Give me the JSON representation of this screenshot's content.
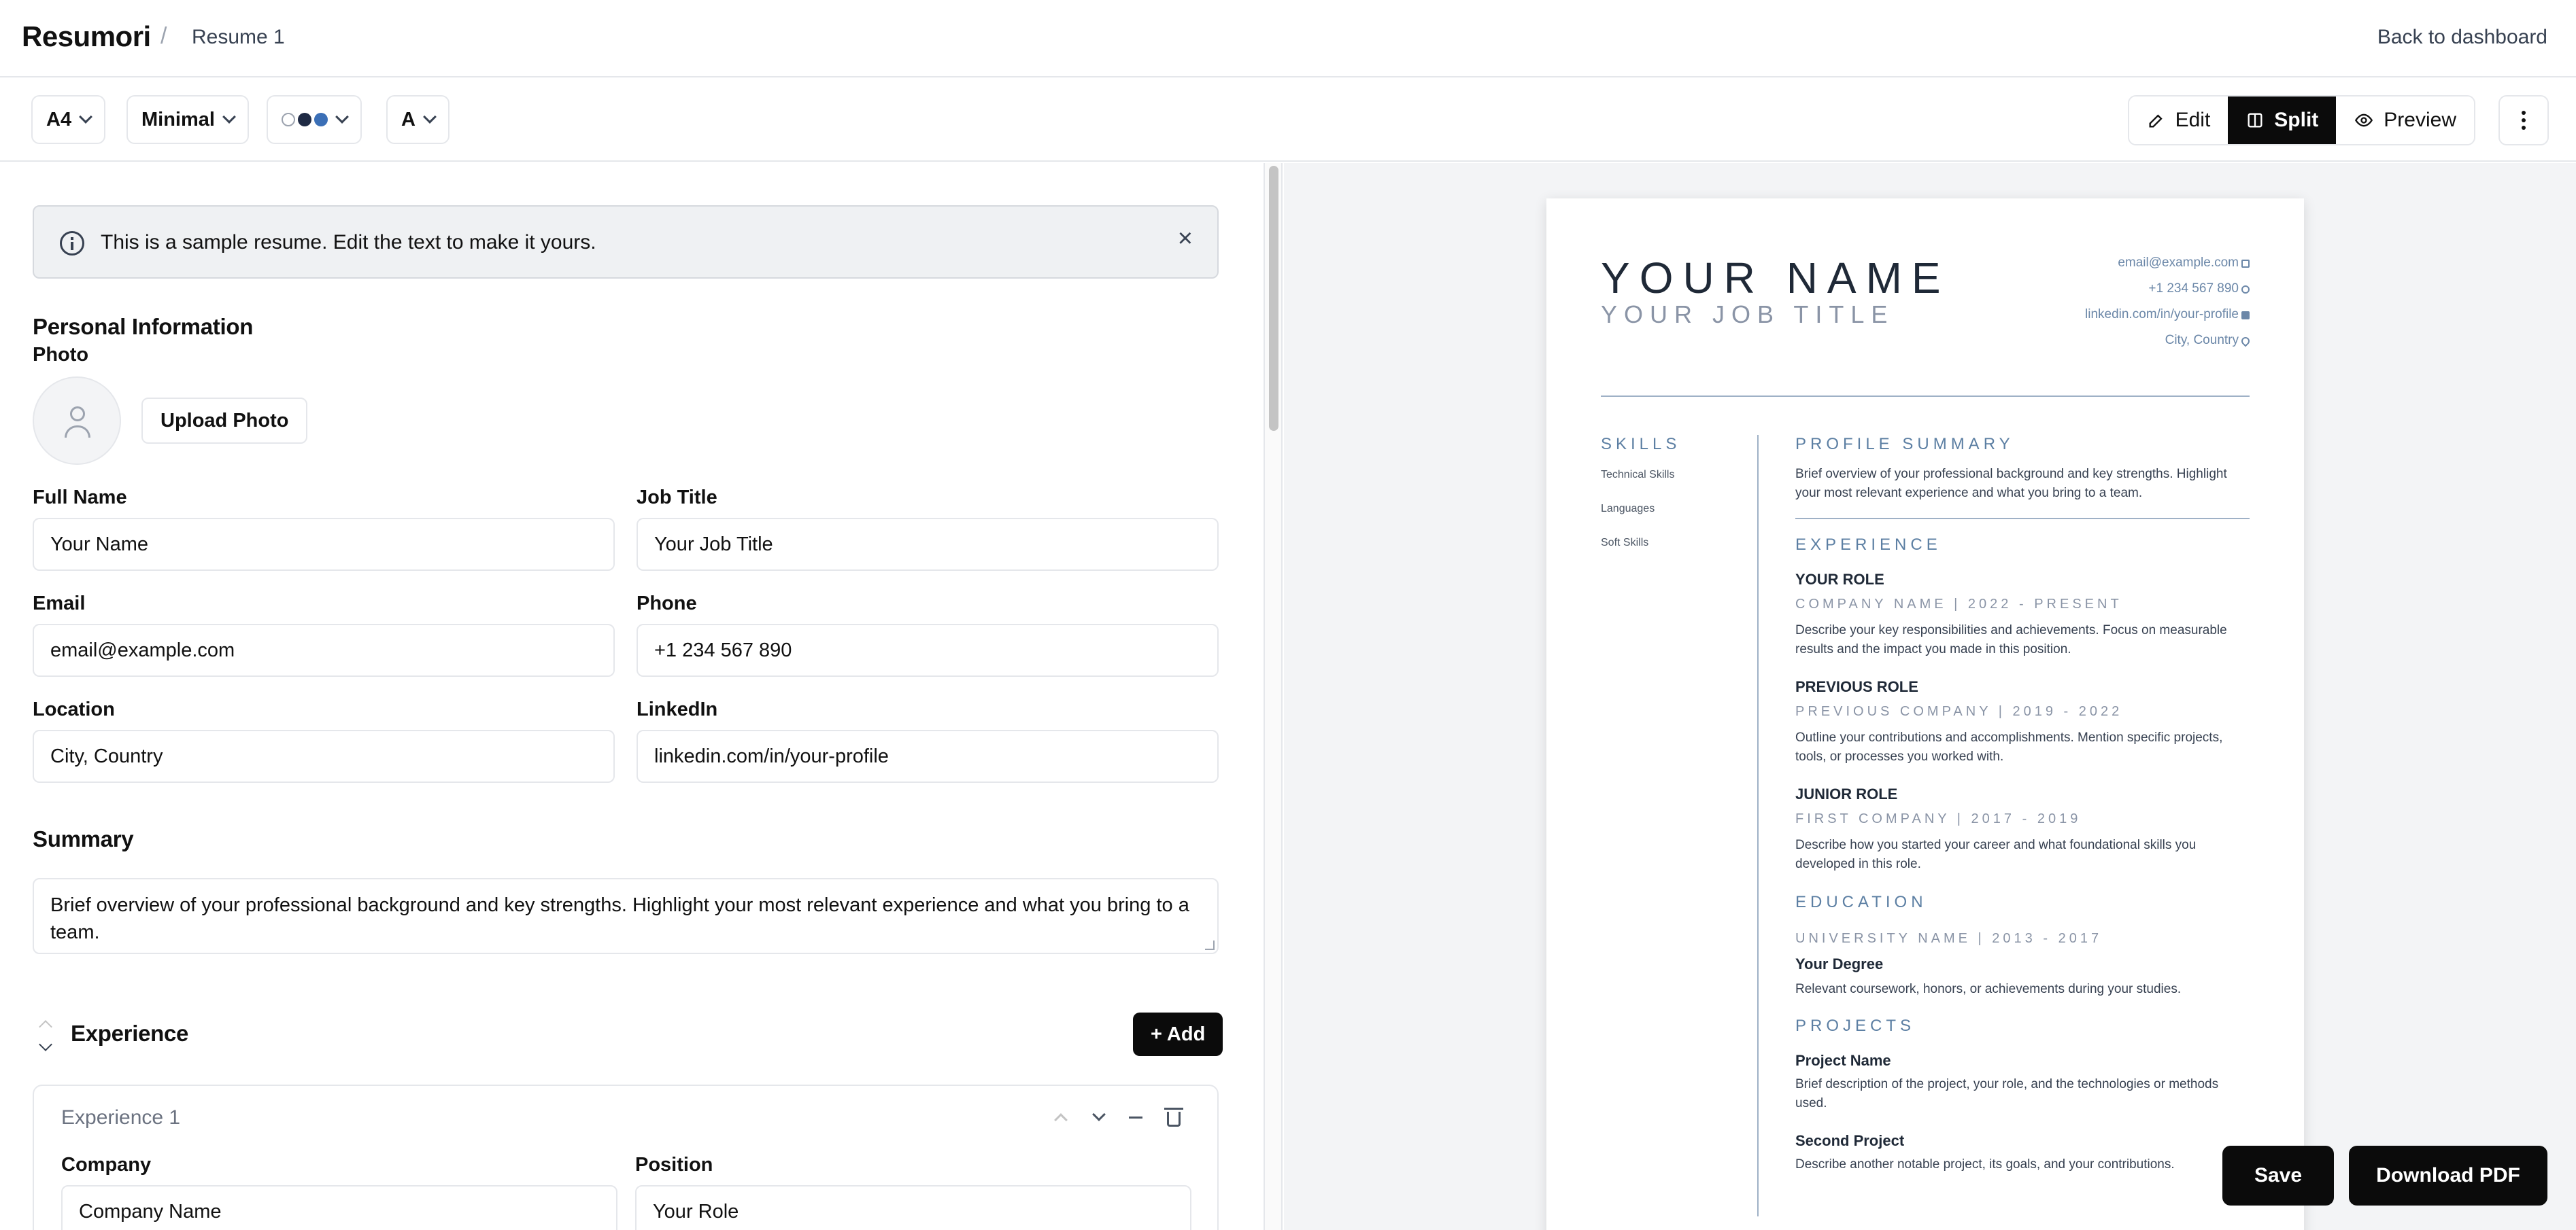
{
  "header": {
    "brand": "Resumori",
    "separator": "/",
    "breadcrumb": "Resume 1",
    "back_link": "Back to dashboard"
  },
  "toolbar": {
    "page_size": "A4",
    "template": "Minimal",
    "palette_colors": [
      "#ffffff",
      "#1f2a44",
      "#3b6fb6"
    ],
    "font": "A",
    "views": {
      "edit": "Edit",
      "split": "Split",
      "preview": "Preview"
    },
    "active_view": "Split",
    "icons": [
      "pencil-icon",
      "columns-icon",
      "eye-icon",
      "more-vertical-icon"
    ]
  },
  "notice": {
    "text": "This is a sample resume. Edit the text to make it yours.",
    "close": "×"
  },
  "personal": {
    "heading": "Personal Information",
    "photo_label": "Photo",
    "upload_label": "Upload Photo",
    "full_name_label": "Full Name",
    "full_name": "Your Name",
    "job_title_label": "Job Title",
    "job_title": "Your Job Title",
    "email_label": "Email",
    "email": "email@example.com",
    "phone_label": "Phone",
    "phone": "+1 234 567 890",
    "location_label": "Location",
    "location": "City, Country",
    "linkedin_label": "LinkedIn",
    "linkedin": "linkedin.com/in/your-profile"
  },
  "summary": {
    "heading": "Summary",
    "text": "Brief overview of your professional background and key strengths. Highlight your most relevant experience and what you bring to a team."
  },
  "experience": {
    "heading": "Experience",
    "add_label": "+ Add",
    "card_title": "Experience 1",
    "company_label": "Company",
    "company": "Company Name",
    "position_label": "Position",
    "position": "Your Role"
  },
  "resume": {
    "name": "YOUR NAME",
    "title": "YOUR JOB TITLE",
    "contacts": [
      "email@example.com",
      "+1 234 567 890",
      "linkedin.com/in/your-profile",
      "City, Country"
    ],
    "skills_heading": "SKILLS",
    "skills": [
      "Technical Skills",
      "Languages",
      "Soft Skills"
    ],
    "profile_heading": "PROFILE SUMMARY",
    "profile_text": "Brief overview of your professional background and key strengths. Highlight your most relevant experience and what you bring to a team.",
    "experience_heading": "EXPERIENCE",
    "jobs": [
      {
        "role": "YOUR ROLE",
        "meta": "COMPANY NAME  |  2022 - PRESENT",
        "desc": "Describe your key responsibilities and achievements. Focus on measurable results and the impact you made in this position."
      },
      {
        "role": "PREVIOUS ROLE",
        "meta": "PREVIOUS COMPANY  |  2019 - 2022",
        "desc": "Outline your contributions and accomplishments. Mention specific projects, tools, or processes you worked with."
      },
      {
        "role": "JUNIOR ROLE",
        "meta": "FIRST COMPANY  |  2017 - 2019",
        "desc": "Describe how you started your career and what foundational skills you developed in this role."
      }
    ],
    "education_heading": "EDUCATION",
    "education": {
      "meta": "UNIVERSITY NAME  |  2013 - 2017",
      "degree": "Your Degree",
      "desc": "Relevant coursework, honors, or achievements during your studies."
    },
    "projects_heading": "PROJECTS",
    "projects": [
      {
        "name": "Project Name",
        "desc": "Brief description of the project, your role, and the technologies or methods used."
      },
      {
        "name": "Second Project",
        "desc": "Describe another notable project, its goals, and your contributions."
      }
    ]
  },
  "actions": {
    "save": "Save",
    "download": "Download PDF"
  }
}
